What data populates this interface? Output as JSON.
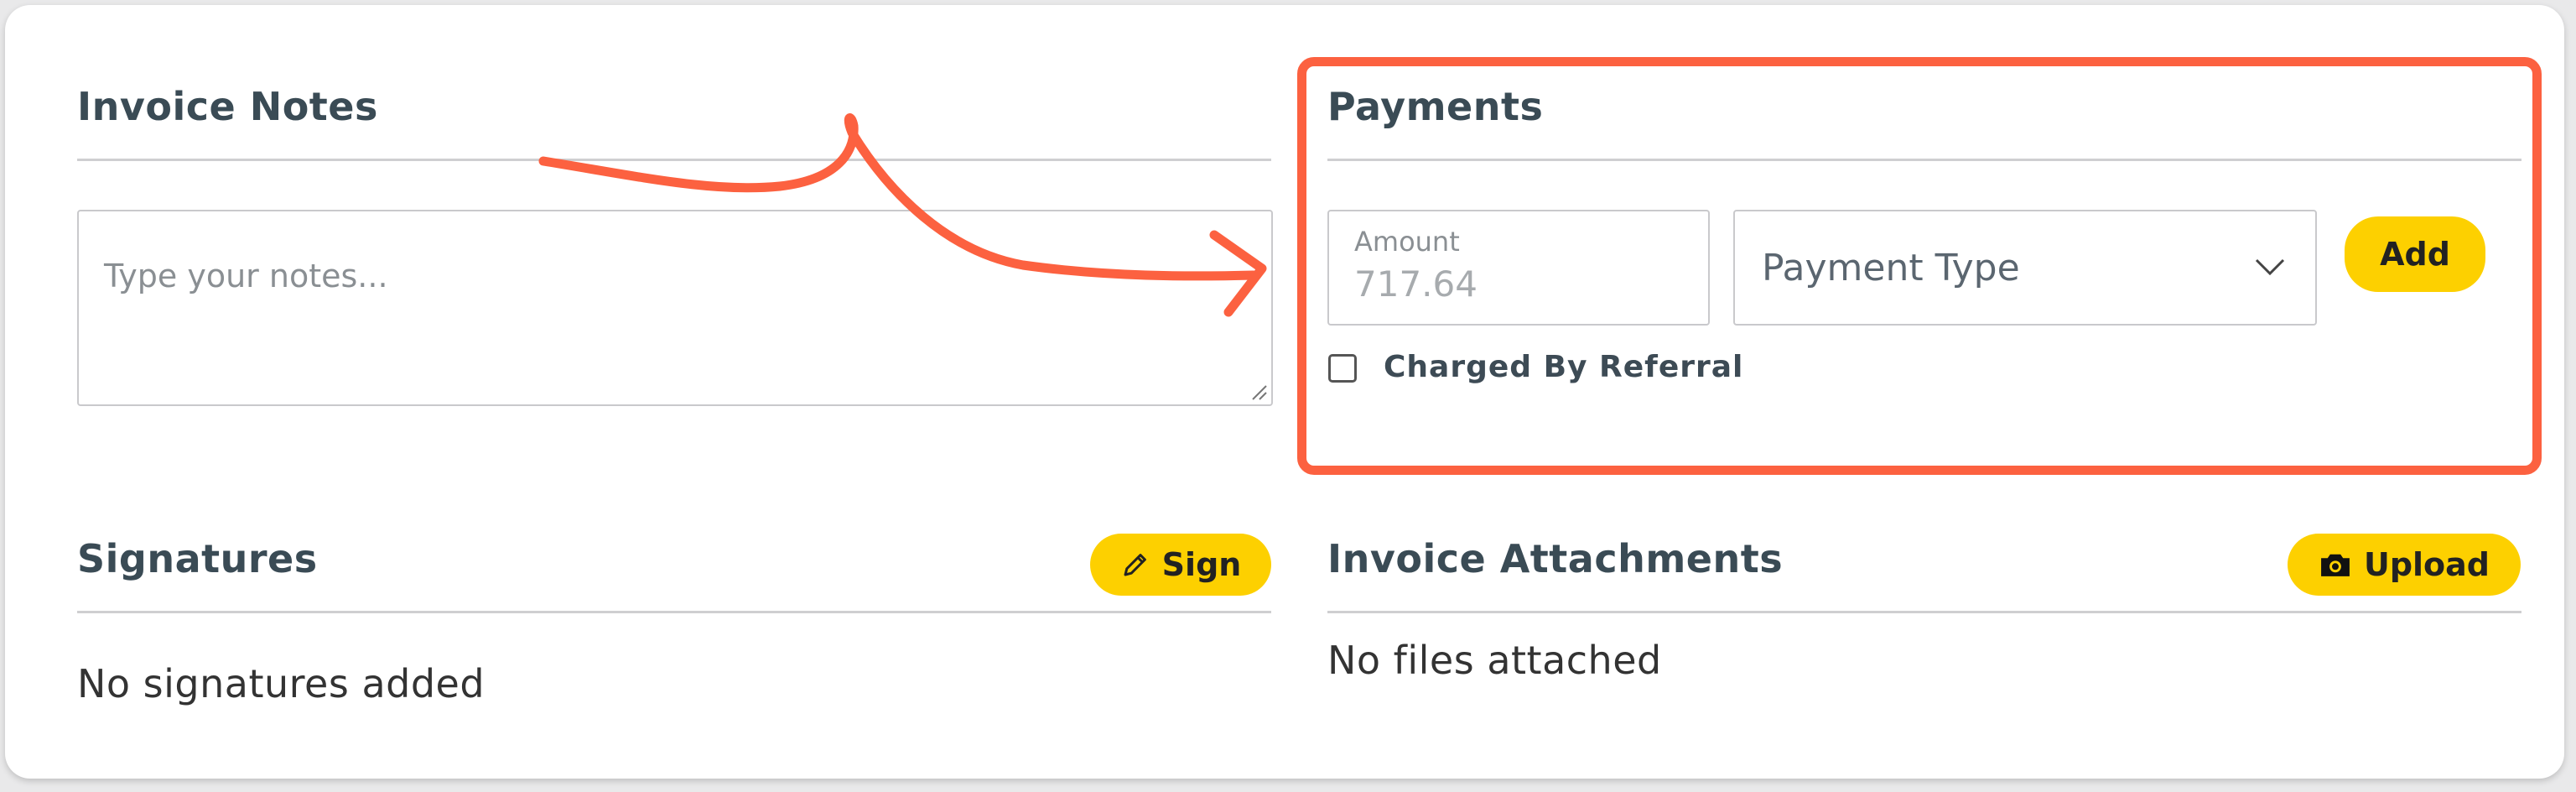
{
  "notes": {
    "title": "Invoice Notes",
    "placeholder": "Type your notes..."
  },
  "payments": {
    "title": "Payments",
    "amount_label": "Amount",
    "amount_value": "717.64",
    "payment_type_placeholder": "Payment Type",
    "add_label": "Add",
    "charged_by_referral_label": "Charged By Referral",
    "charged_by_referral_checked": false
  },
  "signatures": {
    "title": "Signatures",
    "sign_label": "Sign",
    "sign_icon": "pencil-icon",
    "empty_text": "No signatures added"
  },
  "attachments": {
    "title": "Invoice Attachments",
    "upload_label": "Upload",
    "upload_icon": "camera-icon",
    "empty_text": "No files attached"
  },
  "colors": {
    "accent": "#fdd000",
    "annotation": "#fc6140",
    "heading": "#3a4b55"
  }
}
